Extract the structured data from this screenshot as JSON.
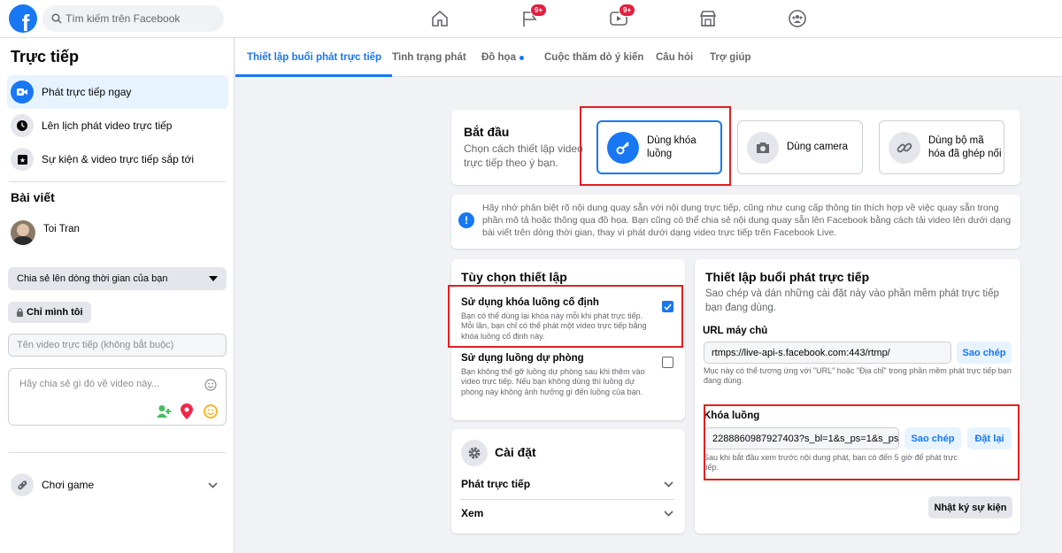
{
  "topbar": {
    "search_placeholder": "Tìm kiếm trên Facebook",
    "badges": {
      "pages": "9+",
      "watch": "9+"
    }
  },
  "sidebar": {
    "title": "Trực tiếp",
    "items": [
      {
        "label": "Phát trực tiếp ngay"
      },
      {
        "label": "Lên lịch phát video trực tiếp"
      },
      {
        "label": "Sự kiện & video trực tiếp sắp tới"
      }
    ],
    "posts_heading": "Bài viết",
    "user_name": "Toi Tran",
    "share_target": "Chia sẻ lên dòng thời gian của bạn",
    "privacy": "Chỉ mình tôi",
    "title_placeholder": "Tên video trực tiếp (không bắt buộc)",
    "desc_placeholder": "Hãy chia sẻ gì đó về video này...",
    "games": "Chơi game"
  },
  "tabs": [
    {
      "label": "Thiết lập buổi phát trực tiếp"
    },
    {
      "label": "Tình trạng phát"
    },
    {
      "label": "Đồ họa"
    },
    {
      "label": "Cuộc thăm dò ý kiến"
    },
    {
      "label": "Câu hỏi"
    },
    {
      "label": "Trợ giúp"
    }
  ],
  "start": {
    "title": "Bắt đầu",
    "subtitle": "Chọn cách thiết lập video trực tiếp theo ý bạn.",
    "options": [
      {
        "label": "Dùng khóa luồng"
      },
      {
        "label": "Dùng camera"
      },
      {
        "label": "Dùng bộ mã hóa đã ghép nối"
      }
    ]
  },
  "notice": "Hãy nhớ phân biệt rõ nội dung quay sẵn với nội dung trực tiếp, cũng như cung cấp thông tin thích hợp về việc quay sẵn trong phần mô tả hoặc thông qua đồ họa. Bạn cũng có thể chia sẻ nội dung quay sẵn lên Facebook bằng cách tải video lên dưới dạng bài viết trên dòng thời gian, thay vì phát dưới dạng video trực tiếp trên Facebook Live.",
  "setup_options": {
    "title": "Tùy chọn thiết lập",
    "persistent_key": {
      "label": "Sử dụng khóa luồng cố định",
      "desc": "Bạn có thể dùng lại khóa này mỗi khi phát trực tiếp. Mỗi lần, bạn chỉ có thể phát một video trực tiếp bằng khóa luồng cố định này.",
      "checked": true
    },
    "backup_stream": {
      "label": "Sử dụng luồng dự phòng",
      "desc": "Bạn không thể gỡ luồng dự phòng sau khi thêm vào video trực tiếp. Nếu bạn không dùng thì luồng dự phòng này không ảnh hưởng gì đến luồng của bạn.",
      "checked": false
    }
  },
  "settings": {
    "title": "Cài đặt",
    "rows": [
      {
        "label": "Phát trực tiếp"
      },
      {
        "label": "Xem"
      }
    ]
  },
  "stream_setup": {
    "title": "Thiết lập buổi phát trực tiếp",
    "subtitle": "Sao chép và dán những cài đặt này vào phần mềm phát trực tiếp bạn đang dùng.",
    "server_label": "URL máy chủ",
    "server_value": "rtmps://live-api-s.facebook.com:443/rtmp/",
    "copy_label": "Sao chép",
    "server_hint": "Mục này có thể tương ứng với \"URL\" hoặc \"Địa chỉ\" trong phần mềm phát trực tiếp bạn đang dùng.",
    "key_label": "Khóa luồng",
    "key_value": "2288860987927403?s_bl=1&s_ps=1&s_ps",
    "reset_label": "Đặt lại",
    "key_hint": "Sau khi bắt đầu xem trước nội dung phát, bạn có đến 5 giờ để phát trực tiếp.",
    "event_log": "Nhật ký sự kiện"
  }
}
